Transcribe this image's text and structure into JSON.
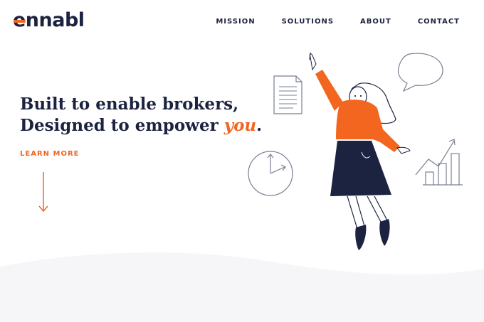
{
  "brand": {
    "logo_text": "ennabl",
    "accent_color": "#f2661f",
    "ink_color": "#1c2340"
  },
  "nav": {
    "items": [
      {
        "label": "MISSION"
      },
      {
        "label": "SOLUTIONS"
      },
      {
        "label": "ABOUT"
      },
      {
        "label": "CONTACT"
      }
    ]
  },
  "hero": {
    "line1": "Built to enable brokers,",
    "line2_prefix": "Designed to empower ",
    "line2_accent": "you",
    "line2_suffix": ".",
    "cta_label": "LEARN MORE",
    "scroll_icon": "arrow-down-icon"
  },
  "illustration": {
    "icons": [
      "document-icon",
      "speech-bubble-icon",
      "clock-icon",
      "growth-chart-icon",
      "woman-pointing-up-figure"
    ]
  }
}
